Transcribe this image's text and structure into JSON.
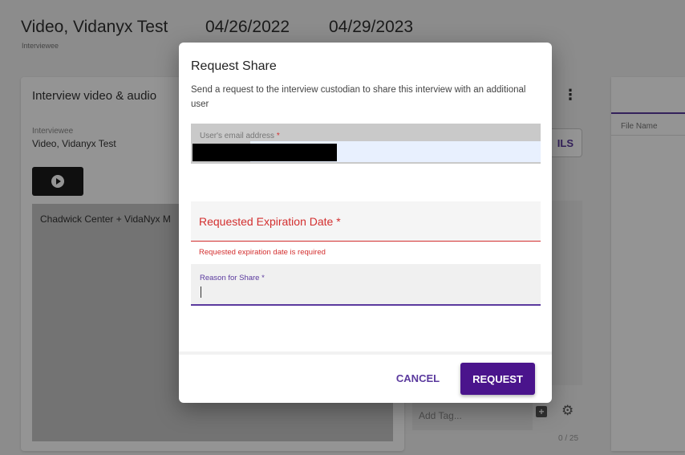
{
  "header": {
    "name": "Video, Vidanyx Test",
    "role": "Interviewee",
    "date_start": "04/26/2022",
    "date_end": "04/29/2023"
  },
  "left_card": {
    "title": "Interview video & audio",
    "interviewee_label": "Interviewee",
    "interviewee_value": "Video, Vidanyx Test",
    "video_caption": "Chadwick Center + VidaNyx M"
  },
  "middle": {
    "details_label": "ILS",
    "tag_placeholder": "Add Tag...",
    "tag_counter": "0 / 25"
  },
  "right_card": {
    "column_header": "File Name"
  },
  "dialog": {
    "title": "Request Share",
    "description": "Send a request to the interview custodian to share this interview with an additional user",
    "email_label": "User's email address",
    "required_mark": "*",
    "expiration_label": "Requested Expiration Date *",
    "expiration_error": "Requested expiration date is required",
    "reason_label": "Reason for Share *",
    "cancel_label": "CANCEL",
    "request_label": "REQUEST"
  },
  "colors": {
    "accent": "#4a148c",
    "accent_text": "#5b3a9e",
    "error": "#d32f2f"
  },
  "icons": {
    "play": "play-icon",
    "kebab": "more-vert-icon",
    "add_tag": "add-box-icon",
    "settings": "gear-icon"
  }
}
